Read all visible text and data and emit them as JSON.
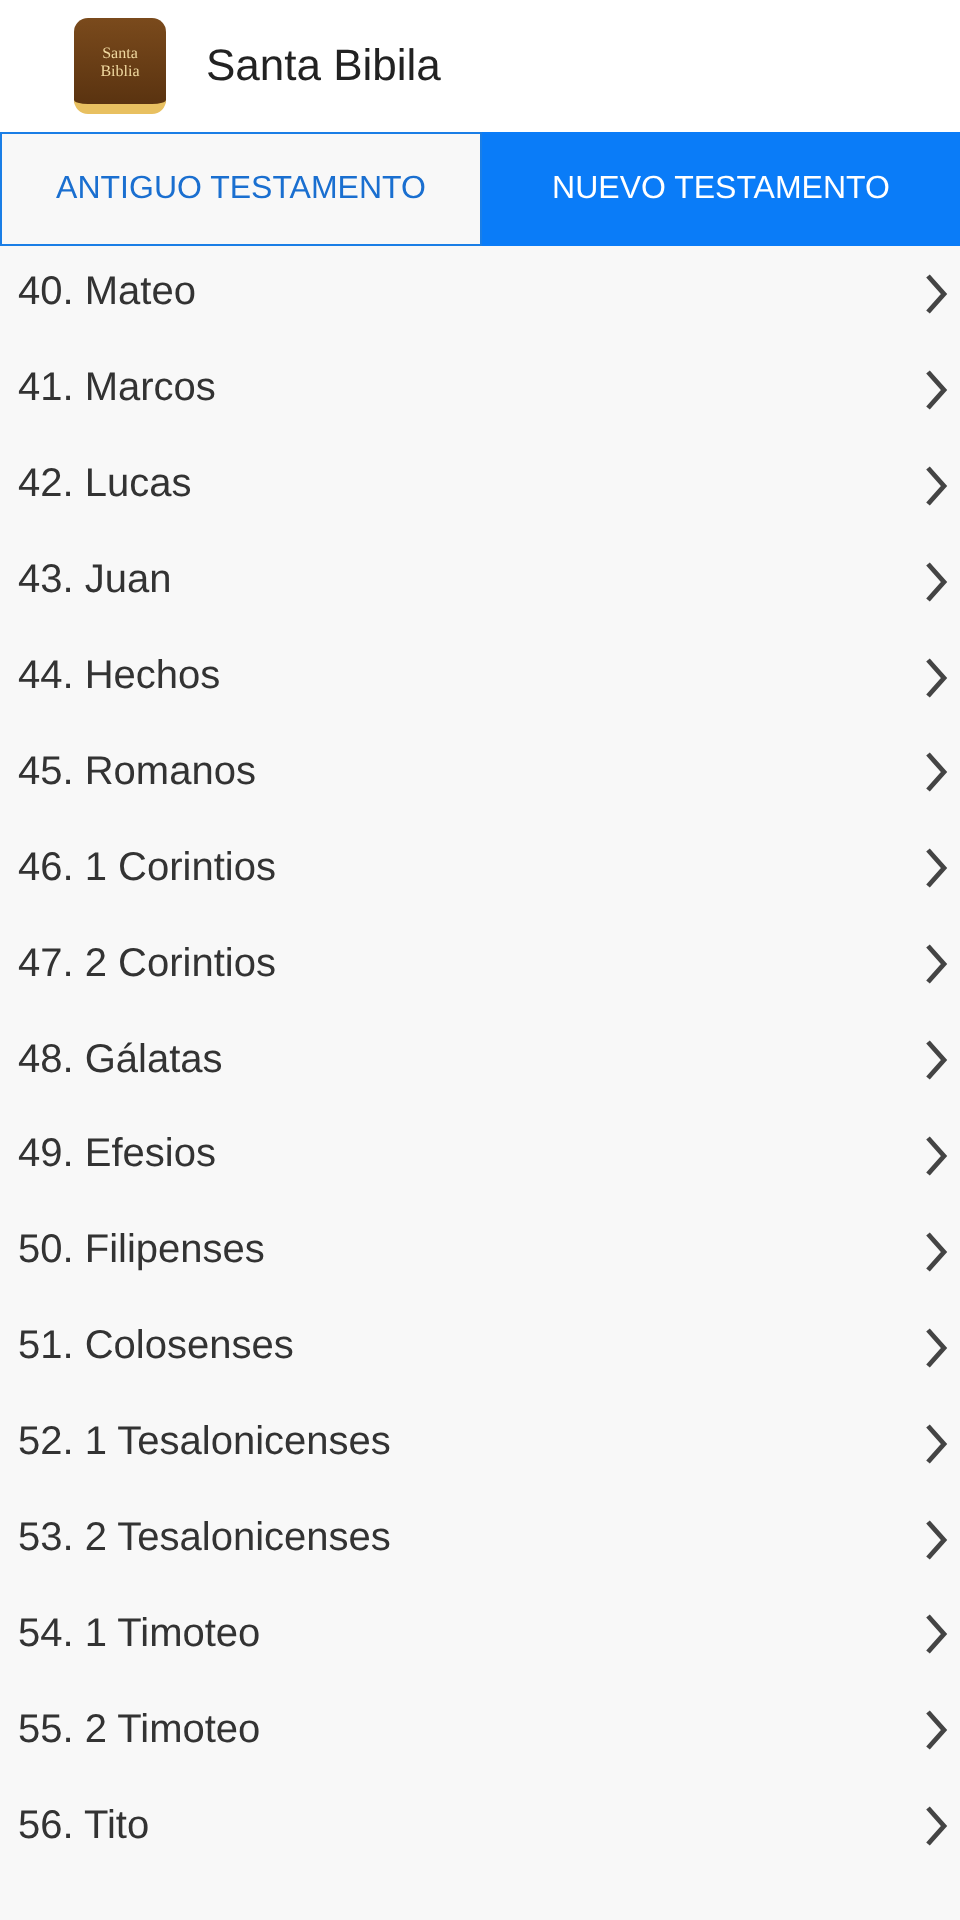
{
  "app_bar": {
    "logo_text": [
      "Santa",
      "Biblia"
    ],
    "title": "Santa Bibila"
  },
  "tabs": [
    {
      "label": "ANTIGUO TESTAMENTO",
      "selected": false
    },
    {
      "label": "NUEVO TESTAMENTO",
      "selected": true
    }
  ],
  "books": [
    {
      "label": "40. Mateo"
    },
    {
      "label": "41. Marcos"
    },
    {
      "label": "42. Lucas"
    },
    {
      "label": "43. Juan"
    },
    {
      "label": "44. Hechos"
    },
    {
      "label": "45. Romanos"
    },
    {
      "label": "46. 1 Corintios"
    },
    {
      "label": "47. 2 Corintios"
    },
    {
      "label": "48. Gálatas"
    },
    {
      "label": "49. Efesios"
    },
    {
      "label": "50. Filipenses"
    },
    {
      "label": "51. Colosenses"
    },
    {
      "label": "52. 1 Tesalonicenses"
    },
    {
      "label": "53. 2 Tesalonicenses"
    },
    {
      "label": "54. 1 Timoteo"
    },
    {
      "label": "55. 2 Timoteo"
    },
    {
      "label": "56. Tito"
    }
  ]
}
